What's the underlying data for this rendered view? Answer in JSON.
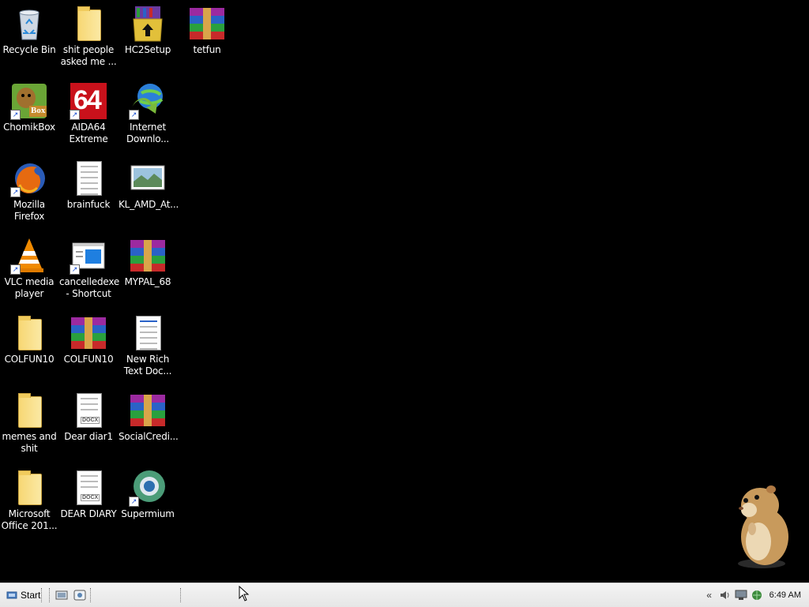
{
  "desktop": {
    "icons": [
      {
        "label": "Recycle Bin",
        "icon": "recycle-bin-icon",
        "shortcut": false
      },
      {
        "label": "shit people asked me ...",
        "icon": "folder-icon",
        "shortcut": false
      },
      {
        "label": "HC2Setup",
        "icon": "installer-box-icon",
        "shortcut": false
      },
      {
        "label": "tetfun",
        "icon": "winrar-archive-icon",
        "shortcut": false
      },
      {
        "label": "ChomikBox",
        "icon": "chomikbox-icon",
        "shortcut": true
      },
      {
        "label": "AIDA64 Extreme",
        "icon": "aida64-icon",
        "shortcut": true
      },
      {
        "label": "Internet Downlo...",
        "icon": "internet-download-manager-icon",
        "shortcut": true
      },
      {
        "label": "Mozilla Firefox",
        "icon": "firefox-icon",
        "shortcut": true
      },
      {
        "label": "brainfuck",
        "icon": "text-document-icon",
        "shortcut": false
      },
      {
        "label": "KL_AMD_At...",
        "icon": "image-file-icon",
        "shortcut": false
      },
      {
        "label": "VLC media player",
        "icon": "vlc-icon",
        "shortcut": true
      },
      {
        "label": "cancelledexe - Shortcut",
        "icon": "window-shortcut-icon",
        "shortcut": true
      },
      {
        "label": "MYPAL_68",
        "icon": "winrar-archive-icon",
        "shortcut": false
      },
      {
        "label": "COLFUN10",
        "icon": "folder-icon",
        "shortcut": false
      },
      {
        "label": "COLFUN10",
        "icon": "winrar-archive-icon",
        "shortcut": false
      },
      {
        "label": "New Rich Text Doc...",
        "icon": "rich-text-document-icon",
        "shortcut": false
      },
      {
        "label": "memes and shit",
        "icon": "folder-icon",
        "shortcut": false
      },
      {
        "label": "Dear diar1",
        "icon": "docx-document-icon",
        "shortcut": false
      },
      {
        "label": "SocialCredi...",
        "icon": "winrar-archive-icon",
        "shortcut": false
      },
      {
        "label": "Microsoft Office 201...",
        "icon": "folder-icon",
        "shortcut": false
      },
      {
        "label": "DEAR DIARY",
        "icon": "docx-document-icon",
        "shortcut": false
      },
      {
        "label": "Supermium",
        "icon": "supermium-browser-icon",
        "shortcut": true
      }
    ],
    "background_color": "#000000",
    "decoration": "hamster-desktop-pet"
  },
  "taskbar": {
    "start_label": "Start",
    "quick_launch": [
      "show-desktop-icon",
      "browser-icon"
    ],
    "tray_icons": [
      "chevron-left-icon",
      "speaker-icon",
      "network-icon",
      "internet-icon"
    ],
    "clock": "6:49 AM"
  },
  "labels": {
    "docx": "DOCX",
    "aida": "64",
    "chomik": "Box"
  }
}
